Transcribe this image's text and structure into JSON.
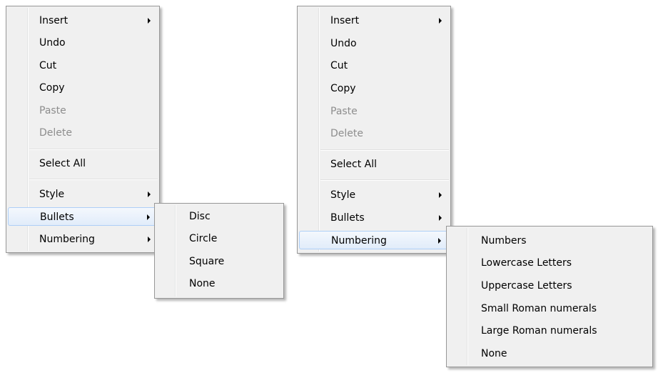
{
  "left_menu": {
    "items": [
      {
        "label": "Insert"
      },
      {
        "label": "Undo"
      },
      {
        "label": "Cut"
      },
      {
        "label": "Copy"
      },
      {
        "label": "Paste"
      },
      {
        "label": "Delete"
      },
      {
        "label": "Select All"
      },
      {
        "label": "Style"
      },
      {
        "label": "Bullets"
      },
      {
        "label": "Numbering"
      }
    ]
  },
  "bullets_submenu": {
    "items": [
      {
        "label": "Disc"
      },
      {
        "label": "Circle"
      },
      {
        "label": "Square"
      },
      {
        "label": "None"
      }
    ]
  },
  "right_menu": {
    "items": [
      {
        "label": "Insert"
      },
      {
        "label": "Undo"
      },
      {
        "label": "Cut"
      },
      {
        "label": "Copy"
      },
      {
        "label": "Paste"
      },
      {
        "label": "Delete"
      },
      {
        "label": "Select All"
      },
      {
        "label": "Style"
      },
      {
        "label": "Bullets"
      },
      {
        "label": "Numbering"
      }
    ]
  },
  "numbering_submenu": {
    "items": [
      {
        "label": "Numbers"
      },
      {
        "label": "Lowercase Letters"
      },
      {
        "label": "Uppercase Letters"
      },
      {
        "label": "Small Roman numerals"
      },
      {
        "label": "Large Roman numerals"
      },
      {
        "label": "None"
      }
    ]
  },
  "colors": {
    "menu_background": "#f0f0f0",
    "menu_border": "#979797",
    "highlight_border": "#aecff7",
    "disabled_text": "#8d8d8d"
  }
}
